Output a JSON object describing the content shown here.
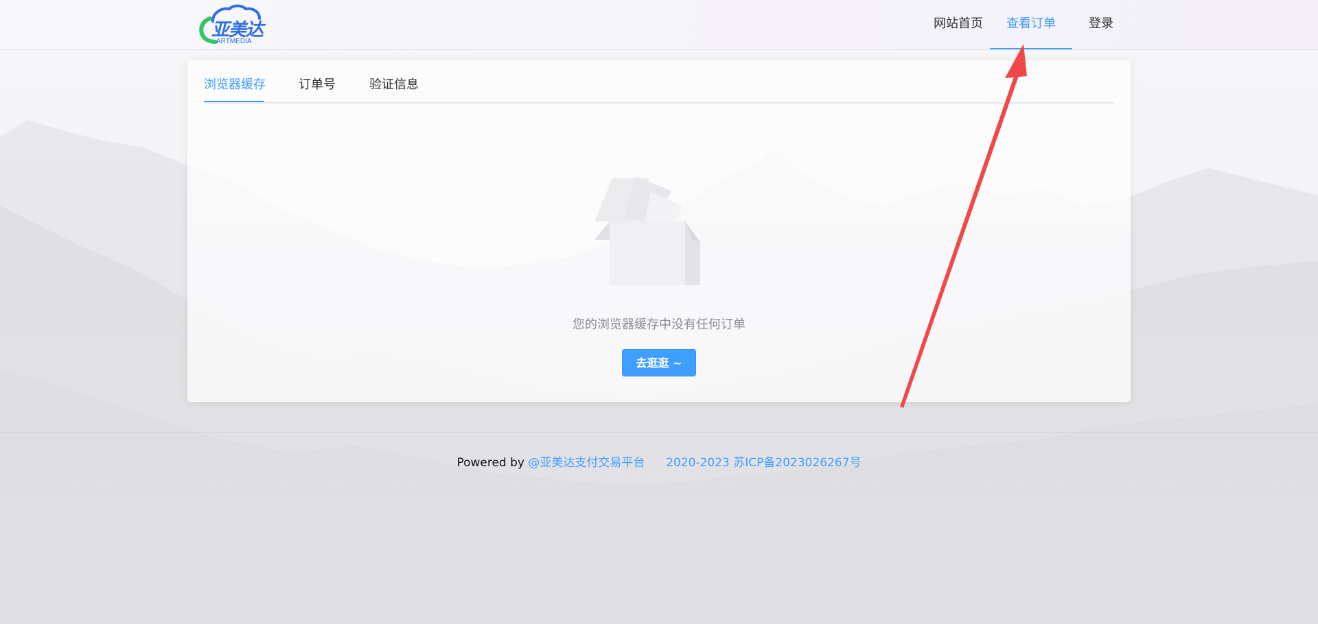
{
  "brand": {
    "name": "亚美达",
    "sub": "ARTMEDIA",
    "colors": {
      "primary": "#409eff",
      "logo_blue": "#2f6fe0",
      "logo_green": "#35c46a"
    }
  },
  "nav": {
    "items": [
      {
        "label": "网站首页"
      },
      {
        "label": "查看订单"
      },
      {
        "label": "登录"
      }
    ],
    "active_index": 1
  },
  "tabs": {
    "items": [
      {
        "label": "浏览器缓存"
      },
      {
        "label": "订单号"
      },
      {
        "label": "验证信息"
      }
    ],
    "active_index": 0
  },
  "empty": {
    "icon": "empty-box-icon",
    "message": "您的浏览器缓存中没有任何订单",
    "button_label": "去逛逛 ~"
  },
  "footer": {
    "powered_by": "Powered by",
    "platform_link": "@亚美达支付交易平台",
    "copyright": "2020-2023 苏ICP备2023026267号"
  },
  "annotation": {
    "icon": "red-arrow-icon",
    "color": "#f04848"
  }
}
